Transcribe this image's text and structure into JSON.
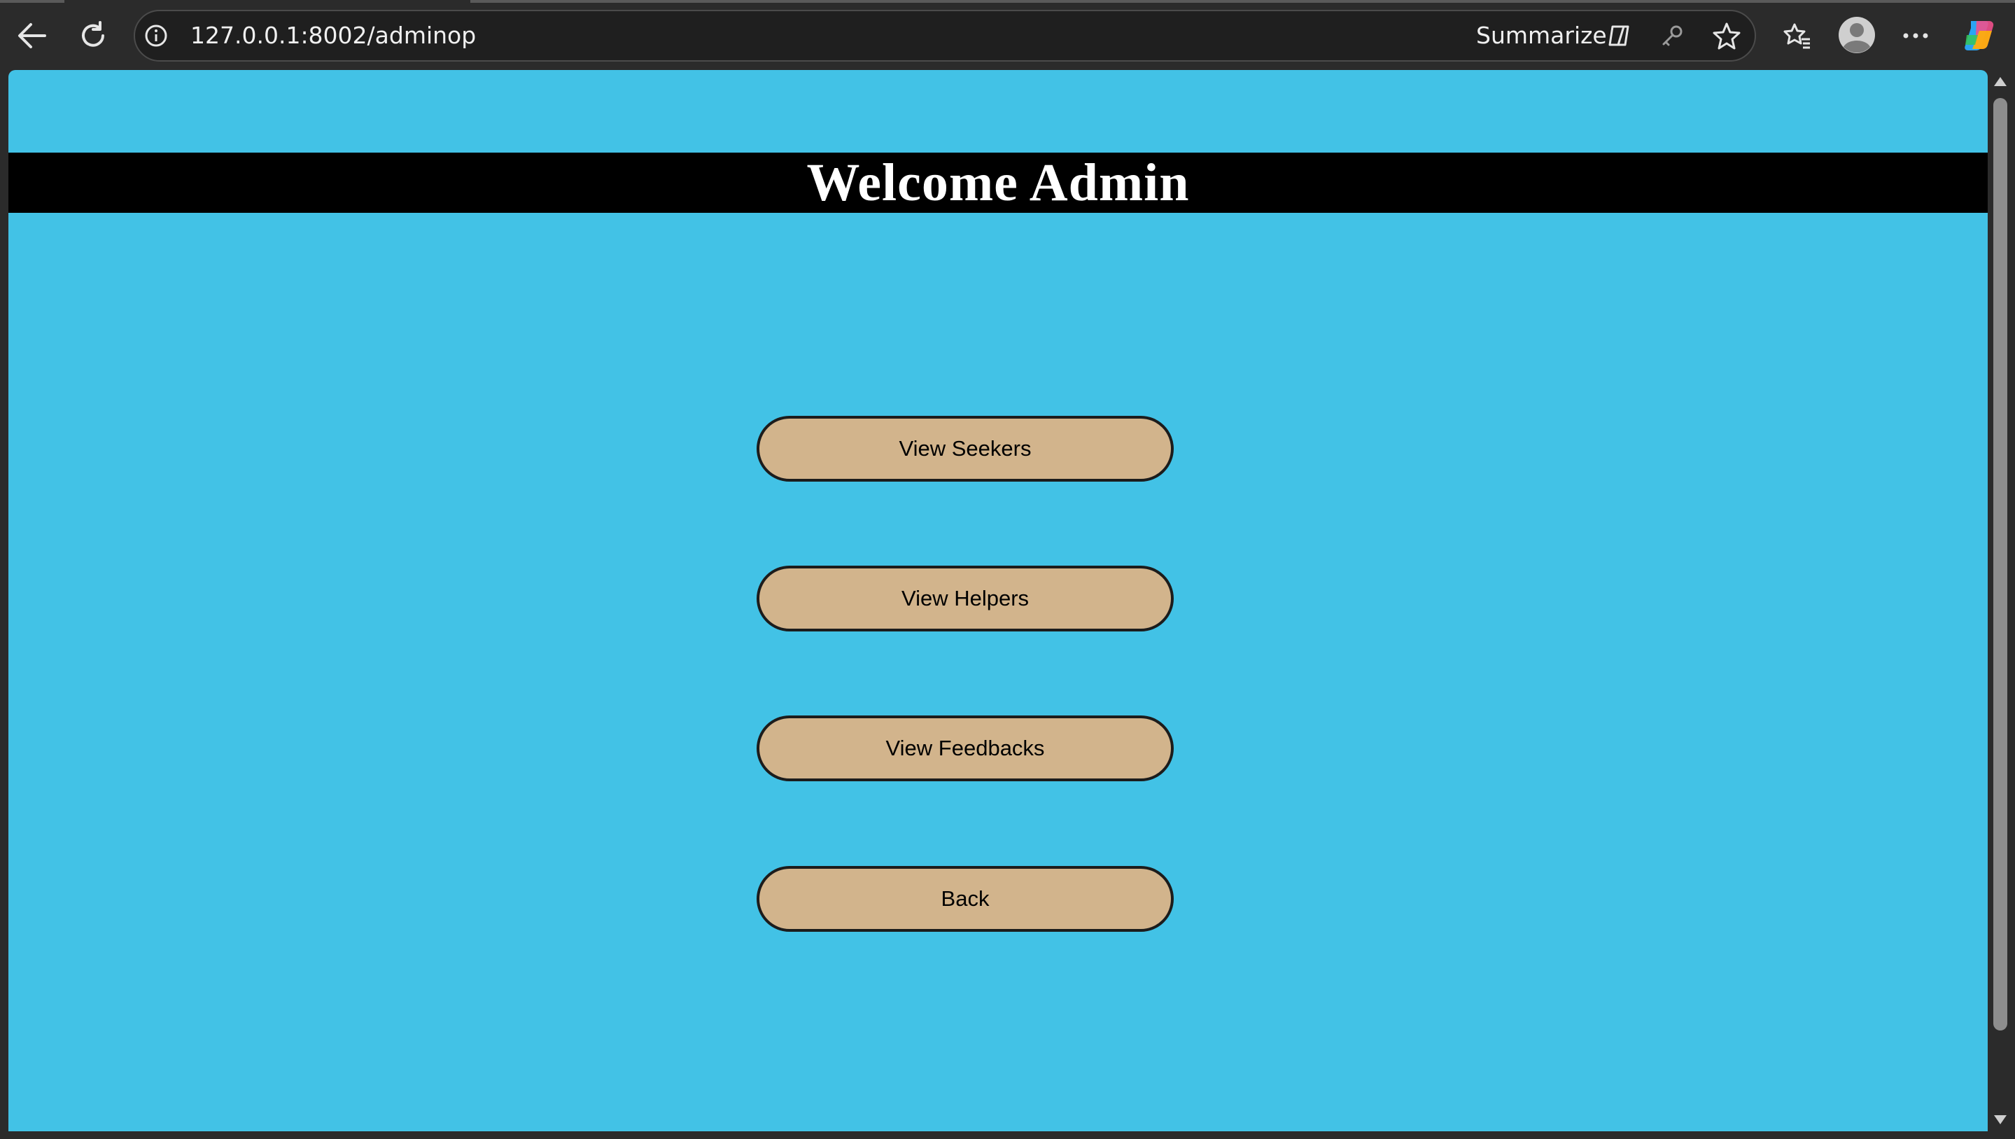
{
  "browser": {
    "url": "127.0.0.1:8002/adminop",
    "summarize_label": "Summarize",
    "icons": [
      "back-icon",
      "refresh-icon",
      "info-icon",
      "copilot-summarize-icon",
      "key-icon",
      "star-icon",
      "favorites-icon",
      "profile-icon",
      "more-icon",
      "copilot-icon"
    ]
  },
  "page": {
    "header_title": "Welcome Admin",
    "background_color": "#42c2e6",
    "button_color": "#d2b48c",
    "buttons": [
      {
        "label": "View Seekers"
      },
      {
        "label": "View Helpers"
      },
      {
        "label": "View Feedbacks"
      },
      {
        "label": "Back"
      }
    ]
  }
}
